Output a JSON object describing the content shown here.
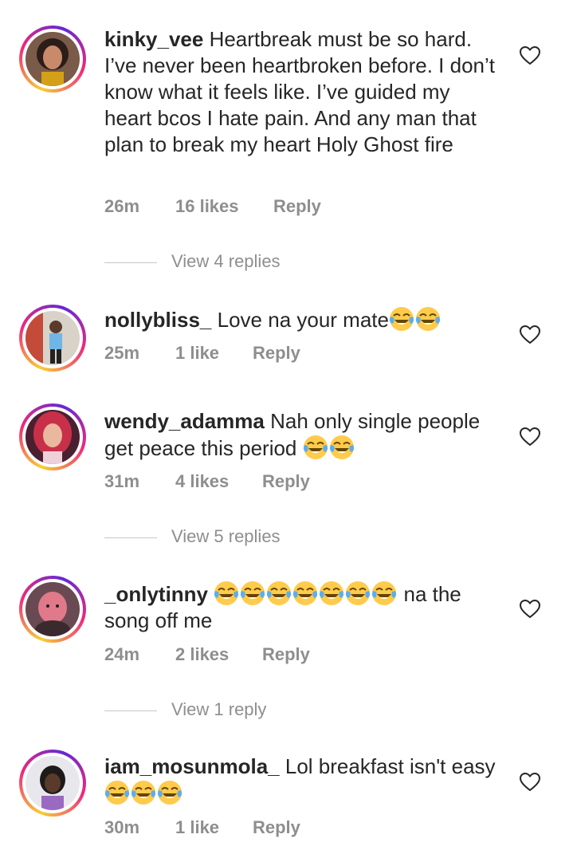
{
  "comments": [
    {
      "username": "kinky_vee",
      "text": "Heartbreak must be so hard. I’ve never been heartbroken before. I don’t know what it feels like. I’ve guided my heart bcos I hate pain. And any man that plan to break my heart Holy Ghost fire",
      "time": "26m",
      "likes": "16 likes",
      "reply": "Reply",
      "view_replies": "View 4 replies",
      "avatar_icon": "profile-photo"
    },
    {
      "username": "nollybliss_",
      "text": "Love na your mate",
      "emoji_count": 2,
      "time": "25m",
      "likes": "1 like",
      "reply": "Reply",
      "avatar_icon": "profile-photo"
    },
    {
      "username": "wendy_adamma",
      "text": "Nah only single people get peace this period",
      "emoji_count": 2,
      "time": "31m",
      "likes": "4 likes",
      "reply": "Reply",
      "view_replies": "View 5 replies",
      "avatar_icon": "profile-photo"
    },
    {
      "username": "_onlytinny",
      "text_before_emoji": "",
      "emoji_count": 7,
      "text": "na the song off me",
      "time": "24m",
      "likes": "2 likes",
      "reply": "Reply",
      "view_replies": "View 1 reply",
      "avatar_icon": "profile-photo"
    },
    {
      "username": "iam_mosunmola_",
      "text": "Lol breakfast isn't easy",
      "emoji_count": 3,
      "time": "30m",
      "likes": "1 like",
      "reply": "Reply",
      "avatar_icon": "profile-photo"
    }
  ],
  "icons": {
    "like": "heart-outline-icon",
    "emoji": "face-with-tears-of-joy"
  },
  "colors": {
    "text": "#262626",
    "meta": "#8e8e8e",
    "ring_start": "#f9ce34",
    "ring_mid": "#ee2a7b",
    "ring_end": "#6228d7"
  }
}
